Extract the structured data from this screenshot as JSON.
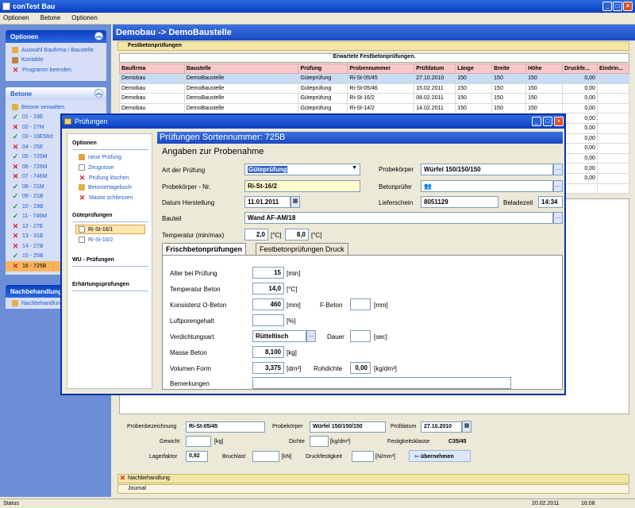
{
  "app": {
    "title": "conTest Bau"
  },
  "menu": [
    "Optionen",
    "Betone",
    "Optionen"
  ],
  "left": {
    "optionen": {
      "title": "Optionen",
      "items": [
        "Auswahl Baufirma / Baustelle",
        "Kontakte",
        "Programm beenden"
      ]
    },
    "betone": {
      "title": "Betone",
      "items": [
        {
          "label": "Betone verwalten",
          "mark": "none"
        },
        {
          "label": "01 - 19E",
          "mark": "ok"
        },
        {
          "label": "02 - 27M",
          "mark": "no"
        },
        {
          "label": "03 - 19E56d",
          "mark": "ok"
        },
        {
          "label": "04 - 25E",
          "mark": "no"
        },
        {
          "label": "05 - 725M",
          "mark": "ok"
        },
        {
          "label": "06 - 726M",
          "mark": "no"
        },
        {
          "label": "07 - 746M",
          "mark": "no"
        },
        {
          "label": "08 - 21M",
          "mark": "ok"
        },
        {
          "label": "09 - 21B",
          "mark": "ok"
        },
        {
          "label": "10 - 19B",
          "mark": "ok"
        },
        {
          "label": "11 - 746M",
          "mark": "ok"
        },
        {
          "label": "12 - 27E",
          "mark": "no"
        },
        {
          "label": "13 - 31B",
          "mark": "no"
        },
        {
          "label": "14 - 27B",
          "mark": "no"
        },
        {
          "label": "15 - 25B",
          "mark": "ok"
        },
        {
          "label": "16 - 725B",
          "mark": "no"
        }
      ]
    },
    "nach": {
      "title": "Nachbehandlung",
      "items": [
        "Nachbehandlung"
      ]
    }
  },
  "main": {
    "header": "Demobau -> DemoBaustelle",
    "tab": "Festbetonprüfungen",
    "grid_title": "Erwartete Festbetonprüfungen.",
    "columns": [
      "Baufirma",
      "Baustelle",
      "Prüfung",
      "Probennummer",
      "Prüfdatum",
      "Länge",
      "Breite",
      "Höhe",
      "Druckfe...",
      "Eindrin..."
    ],
    "rows": [
      [
        "Demobau",
        "DemoBaustelle",
        "Güteprüfung",
        "Ri-St-05/45",
        "27.10.2010",
        "150",
        "150",
        "150",
        "0,00",
        ""
      ],
      [
        "Demobau",
        "DemoBaustelle",
        "Güteprüfung",
        "Ri-St-05/46",
        "15.02.2011",
        "150",
        "150",
        "150",
        "0,00",
        ""
      ],
      [
        "Demobau",
        "DemoBaustelle",
        "Güteprüfung",
        "Ri-St-16/2",
        "08.02.2011",
        "150",
        "150",
        "150",
        "0,00",
        ""
      ],
      [
        "Demobau",
        "DemoBaustelle",
        "Güteprüfung",
        "Ri-St-14/2",
        "14.02.2011",
        "150",
        "150",
        "150",
        "0,00",
        ""
      ],
      [
        "",
        "",
        "",
        "",
        "",
        "",
        "",
        "",
        "0,00",
        ""
      ],
      [
        "",
        "",
        "",
        "",
        "",
        "",
        "",
        "",
        "0,00",
        ""
      ],
      [
        "",
        "",
        "",
        "",
        "",
        "",
        "",
        "",
        "0,00",
        ""
      ],
      [
        "",
        "",
        "",
        "",
        "",
        "",
        "",
        "",
        "0,00",
        ""
      ],
      [
        "",
        "",
        "",
        "",
        "",
        "",
        "",
        "",
        "0,00",
        ""
      ],
      [
        "",
        "",
        "",
        "",
        "",
        "",
        "",
        "",
        "0,00",
        ""
      ],
      [
        "",
        "",
        "",
        "",
        "",
        "",
        "",
        "",
        "0,00",
        ""
      ],
      [
        "",
        "",
        "",
        "",
        "",
        "",
        "",
        "",
        "",
        ""
      ]
    ],
    "form": {
      "probenbezeichnung_label": "Probenbezeichnung",
      "probenbezeichnung": "Ri-St-05/45",
      "probekoerper_label": "Probekörper",
      "probekoerper": "Würfel 150/150/150",
      "pruefdatum_label": "Prüfdatum",
      "pruefdatum": "27.10.2010",
      "gewicht_label": "Gewicht",
      "gewicht_unit": "[kg]",
      "dichte_label": "Dichte",
      "dichte_unit": "[kg/dm³]",
      "festigkeitsklasse_label": "Festigkeitsklasse",
      "festigkeitsklasse": "C35/45",
      "lagerfaktor_label": "Lagerfaktor",
      "lagerfaktor": "0,92",
      "bruchlast_label": "Bruchlast",
      "bruchlast_unit": "[kN]",
      "druckfestigkeit_label": "Druckfestigkeit",
      "druckfestigkeit_unit": "[N/mm²]",
      "uebernehmen": "übernehmen"
    },
    "bottom_bars": [
      "Nachbehandlung",
      "Journal"
    ]
  },
  "status": {
    "text": "Status",
    "date": "20.02.2011",
    "time": "16:08"
  },
  "dialog": {
    "title": "Prüfungen",
    "side": {
      "optionen": "Optionen",
      "items": [
        "neue Prüfung",
        "Zeugnisse",
        "Prüfung löschen",
        "Betoniertagebuch",
        "Maske schliessen"
      ],
      "gute": "Güteprüfungen",
      "gute_items": [
        "Ri-St-16/1",
        "Ri-St-16/2"
      ],
      "wu": "WU - Prüfungen",
      "erh": "Erhärtungsprüfungen"
    },
    "header": "Prüfungen Sortennummer: 725B",
    "section": "Angaben zur Probenahme",
    "art_label": "Art der Prüfung",
    "art": "Güteprüfung",
    "probekoerper_label": "Probekörper",
    "probekoerper": "Würfel 150/150/150",
    "nr_label": "Probekörper - Nr.",
    "nr": "Ri-St-16/2",
    "betonpruefer_label": "Betonprüfer",
    "datum_label": "Datum Herstellung",
    "datum": "11.01.2011",
    "lieferschein_label": "Lieferschein",
    "lieferschein": "8051129",
    "beladezeit_label": "Beladezeit",
    "beladezeit": "14:34",
    "bauteil_label": "Bauteil",
    "bauteil": "Wand AF-AM/18",
    "temp_label": "Temperatur (min/max)",
    "temp_min": "2,0",
    "temp_max": "8,0",
    "temp_unit": "[°C]",
    "tabs": [
      "Frischbetonprüfungen",
      "Festbetonprüfungen Druck"
    ],
    "fresh": {
      "alter_label": "Alter bei Prüfung",
      "alter": "15",
      "alter_unit": "[min]",
      "tbeton_label": "Temperatur Beton",
      "tbeton": "14,0",
      "tbeton_unit": "[°C]",
      "konsistenz_label": "Konsistenz O-Beton",
      "konsistenz": "460",
      "konsistenz_unit": "[mm]",
      "fbeton_label": "F-Beton",
      "fbeton_unit": "[mm]",
      "luft_label": "Luftporengehalt",
      "luft_unit": "[%]",
      "verd_label": "Verdichtungsart",
      "verd": "Rütteltisch",
      "dauer_label": "Dauer",
      "dauer_unit": "[sec]",
      "masse_label": "Masse Beton",
      "masse": "8,100",
      "masse_unit": "[kg]",
      "vol_label": "Volumen Form",
      "vol": "3,375",
      "vol_unit": "[dm³]",
      "rohdichte_label": "Rohdichte",
      "rohdichte": "0,00",
      "rohdichte_unit": "[kg/dm³]",
      "bem_label": "Bemerkungen"
    }
  }
}
